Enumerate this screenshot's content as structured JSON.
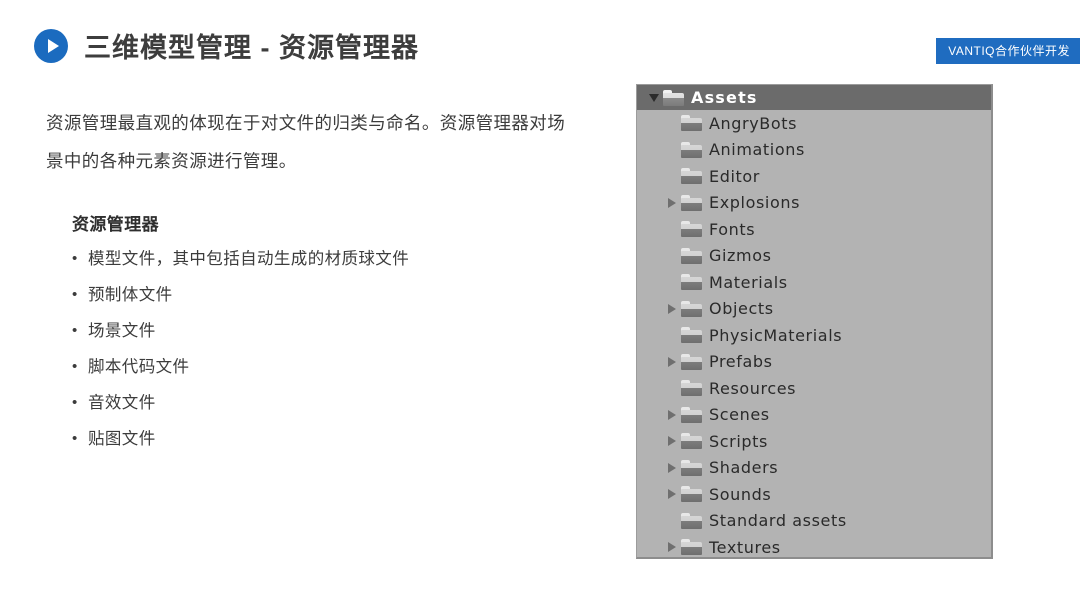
{
  "header": {
    "title": "三维模型管理 - 资源管理器",
    "play_icon": "play-circle-icon"
  },
  "partner_badge": {
    "label": "VANTIQ合作伙伴开发",
    "background": "#1f6cc0",
    "text_color": "#ffffff"
  },
  "body": {
    "paragraph": "资源管理最直观的体现在于对文件的归类与命名。资源管理器对场景中的各种元素资源进行管理。",
    "list_heading": "资源管理器",
    "bullet_marker": "•",
    "bullets": [
      "模型文件，其中包括自动生成的材质球文件",
      "预制体文件",
      "场景文件",
      "脚本代码文件",
      "音效文件",
      "贴图文件"
    ]
  },
  "asset_panel": {
    "root": {
      "label": "Assets",
      "expanded": true,
      "selected": true,
      "arrow": "chevron-down-icon",
      "icon": "folder-icon"
    },
    "items": [
      {
        "label": "AngryBots",
        "expandable": false,
        "icon": "folder-icon"
      },
      {
        "label": "Animations",
        "expandable": false,
        "icon": "folder-icon"
      },
      {
        "label": "Editor",
        "expandable": false,
        "icon": "folder-icon"
      },
      {
        "label": "Explosions",
        "expandable": true,
        "icon": "folder-icon"
      },
      {
        "label": "Fonts",
        "expandable": false,
        "icon": "folder-icon"
      },
      {
        "label": "Gizmos",
        "expandable": false,
        "icon": "folder-icon"
      },
      {
        "label": "Materials",
        "expandable": false,
        "icon": "folder-icon"
      },
      {
        "label": "Objects",
        "expandable": true,
        "icon": "folder-icon"
      },
      {
        "label": "PhysicMaterials",
        "expandable": false,
        "icon": "folder-icon"
      },
      {
        "label": "Prefabs",
        "expandable": true,
        "icon": "folder-icon"
      },
      {
        "label": "Resources",
        "expandable": false,
        "icon": "folder-icon"
      },
      {
        "label": "Scenes",
        "expandable": true,
        "icon": "folder-icon"
      },
      {
        "label": "Scripts",
        "expandable": true,
        "icon": "folder-icon"
      },
      {
        "label": "Shaders",
        "expandable": true,
        "icon": "folder-icon"
      },
      {
        "label": "Sounds",
        "expandable": true,
        "icon": "folder-icon"
      },
      {
        "label": "Standard assets",
        "expandable": false,
        "icon": "folder-icon"
      },
      {
        "label": "Textures",
        "expandable": true,
        "icon": "folder-icon"
      }
    ],
    "colors": {
      "panel_background": "#b3b3b3",
      "selected_row": "#6b6b6b",
      "selected_text": "#ffffff",
      "item_text": "#2a2a2a"
    }
  }
}
